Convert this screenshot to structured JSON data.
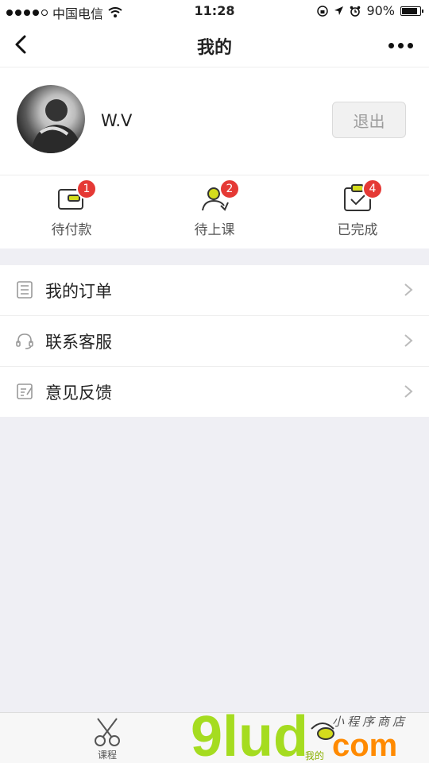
{
  "status_bar": {
    "carrier": "中国电信",
    "time": "11:28",
    "battery": "90%",
    "battery_level": 0.9
  },
  "navbar": {
    "title": "我的"
  },
  "profile": {
    "username": "W.V",
    "logout_label": "退出"
  },
  "orders": [
    {
      "label": "待付款",
      "badge": "1",
      "icon": "wallet-icon"
    },
    {
      "label": "待上课",
      "badge": "2",
      "icon": "person-icon"
    },
    {
      "label": "已完成",
      "badge": "4",
      "icon": "checked-box-icon"
    }
  ],
  "menu": [
    {
      "label": "我的订单",
      "icon": "document-icon"
    },
    {
      "label": "联系客服",
      "icon": "headset-icon"
    },
    {
      "label": "意见反馈",
      "icon": "edit-note-icon"
    }
  ],
  "tabbar": [
    {
      "label": "课程",
      "icon": "scissors-icon"
    },
    {
      "label": "我的",
      "icon": "profile-tab-icon"
    }
  ],
  "watermark": {
    "brand": "9lud",
    "domain": "com",
    "tagline": "小程序商店"
  },
  "colors": {
    "accent_yellow": "#d4dc1c",
    "badge_red": "#e53935",
    "watermark_green": "#a5dc20",
    "watermark_orange": "#ff8a00"
  }
}
